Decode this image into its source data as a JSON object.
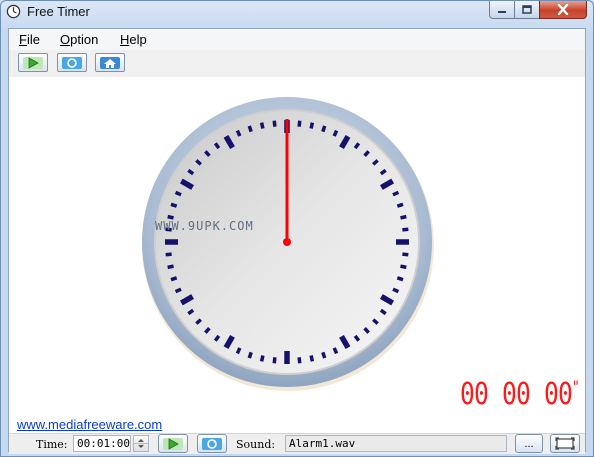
{
  "window": {
    "title": "Free Timer",
    "minimize_label": "",
    "maximize_label": "",
    "close_label": ""
  },
  "menu": {
    "file": {
      "mnemonic": "F",
      "rest": "ile"
    },
    "option": {
      "mnemonic": "O",
      "rest": "ption"
    },
    "help": {
      "mnemonic": "H",
      "rest": "elp"
    }
  },
  "toolbar": {
    "icons": [
      "play-icon",
      "reset-icon",
      "home-icon"
    ]
  },
  "clock": {
    "hand_position": 0,
    "tick_color": "#16116b",
    "hand_color": "#ff0000",
    "bezel_color": "#a9bbd2"
  },
  "watermark": "WWW.9UPK.COM",
  "digital_display": {
    "hours": "00",
    "minutes": "00",
    "seconds": "00",
    "suffix": "\"",
    "color": "#ff1a1a"
  },
  "website_link": "www.mediafreeware.com",
  "statusbar": {
    "time_label": "Time:",
    "time_value": "00:01:00",
    "sound_label": "Sound:",
    "sound_value": "Alarm1.wav",
    "browse_label": "..."
  }
}
